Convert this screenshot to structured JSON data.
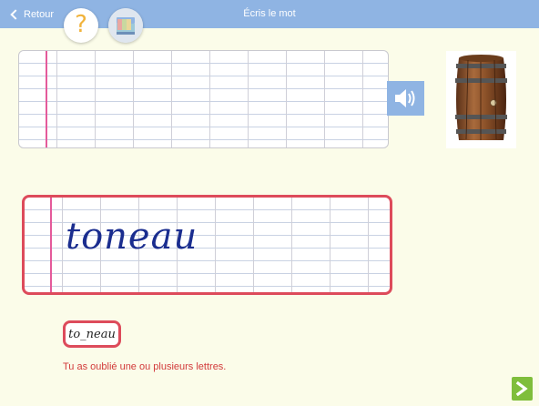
{
  "header": {
    "back_label": "Retour",
    "title": "Écris le mot"
  },
  "toolbar": {
    "help_icon_glyph": "?",
    "help_icon": "question-mark-icon",
    "book_icon": "book-icon"
  },
  "exercise": {
    "sound_icon": "speaker-icon",
    "picture_icon": "barrel-image",
    "answer_text": "toneau",
    "hint_text": "to_neau",
    "feedback_text": "Tu as oublié une ou plusieurs lettres.",
    "next_icon": "chevron-right-icon"
  },
  "colors": {
    "header_bg": "#8fb4e3",
    "page_bg": "#fbfce9",
    "error_red": "#dd4b5b",
    "next_green": "#7fbe3c",
    "margin_pink": "#e45a9a",
    "ink_blue": "#1a2d8f"
  }
}
